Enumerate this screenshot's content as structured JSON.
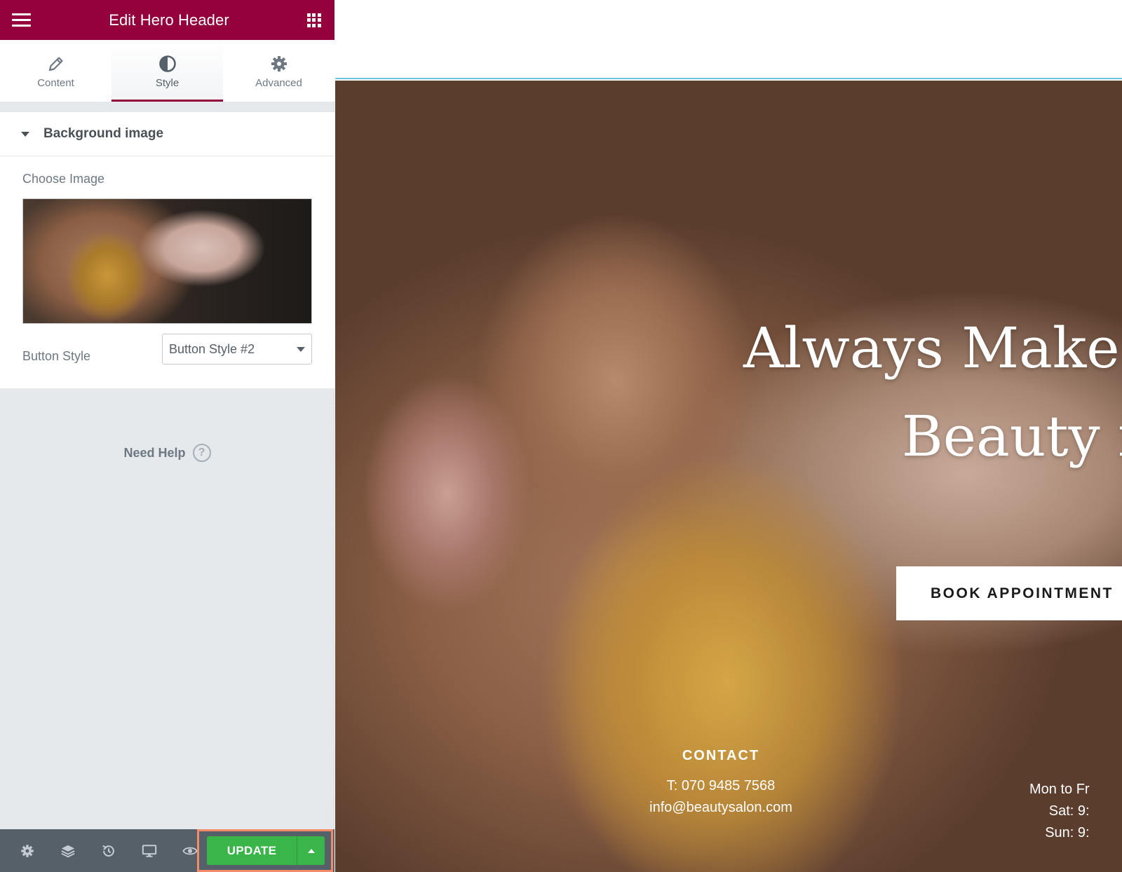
{
  "editor": {
    "title": "Edit Hero Header",
    "tabs": [
      {
        "label": "Content",
        "icon": "pencil-icon"
      },
      {
        "label": "Style",
        "icon": "half-circle-icon"
      },
      {
        "label": "Advanced",
        "icon": "gear-icon"
      }
    ],
    "active_tab": "Style",
    "section": {
      "title": "Background image",
      "choose_image_label": "Choose Image",
      "button_style_label": "Button Style",
      "button_style_value": "Button Style #2"
    },
    "need_help": "Need Help",
    "footer": {
      "icons": [
        "settings-icon",
        "layers-icon",
        "history-icon",
        "responsive-icon",
        "preview-icon"
      ],
      "update_label": "UPDATE"
    },
    "accent_color": "#93003c",
    "update_color": "#39b54a"
  },
  "preview": {
    "hero_title_line1": "Always Make I",
    "hero_title_line2": "Beauty i",
    "cta_label": "BOOK APPOINTMENT",
    "contact": {
      "heading": "CONTACT",
      "phone": "T: 070 9485 7568",
      "email": "info@beautysalon.com"
    },
    "hours": [
      "Mon to Fr",
      "Sat: 9:",
      "Sun: 9:"
    ]
  }
}
